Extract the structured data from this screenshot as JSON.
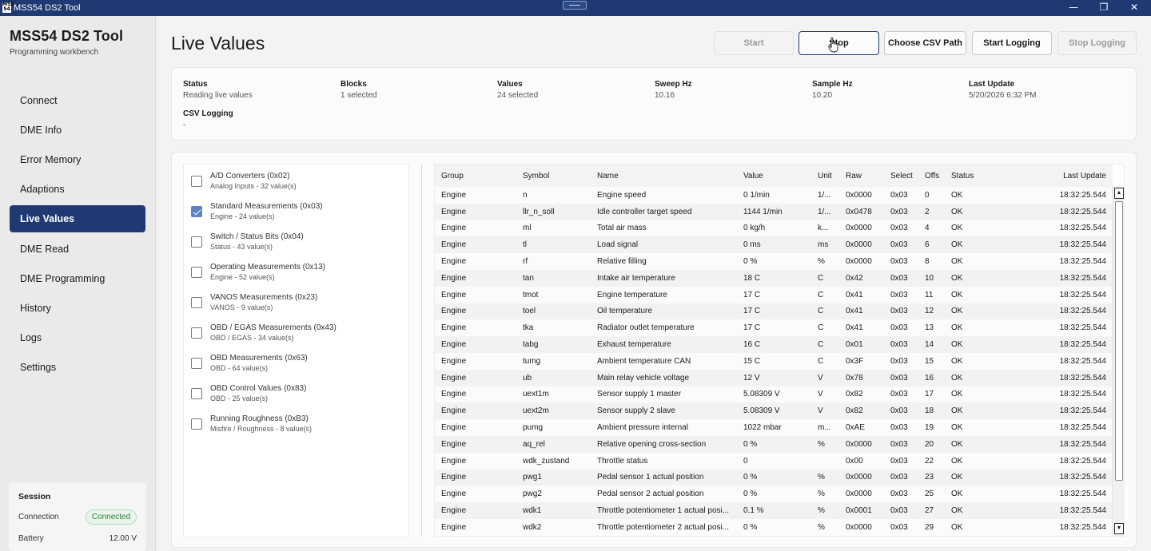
{
  "window": {
    "app_icon_text": "MSS\n54",
    "title": "MSS54 DS2 Tool",
    "minimize": "—",
    "restore": "❐",
    "close": "✕"
  },
  "sidebar": {
    "app_title": "MSS54 DS2 Tool",
    "app_subtitle": "Programming workbench",
    "items": [
      {
        "label": "Connect"
      },
      {
        "label": "DME Info"
      },
      {
        "label": "Error Memory"
      },
      {
        "label": "Adaptions"
      },
      {
        "label": "Live Values"
      },
      {
        "label": "DME Read"
      },
      {
        "label": "DME Programming"
      },
      {
        "label": "History"
      },
      {
        "label": "Logs"
      },
      {
        "label": "Settings"
      }
    ],
    "active_index": 4,
    "session": {
      "title": "Session",
      "connection_label": "Connection",
      "connection_status": "Connected",
      "battery_label": "Battery",
      "battery_value": "12.00 V"
    }
  },
  "header": {
    "page_title": "Live Values",
    "buttons": {
      "start": "Start",
      "stop": "Stop",
      "choose_csv": "Choose CSV Path",
      "start_logging": "Start Logging",
      "stop_logging": "Stop Logging"
    }
  },
  "status": {
    "status_label": "Status",
    "status_value": "Reading live values",
    "blocks_label": "Blocks",
    "blocks_value": "1 selected",
    "values_label": "Values",
    "values_value": "24 selected",
    "sweep_label": "Sweep Hz",
    "sweep_value": "10.16",
    "sample_label": "Sample Hz",
    "sample_value": "10.20",
    "update_label": "Last Update",
    "update_value": "5/20/2026 6:32 PM",
    "csv_label": "CSV Logging",
    "csv_value": "-"
  },
  "blocks": [
    {
      "name": "A/D Converters (0x02)",
      "sub": "Analog Inputs - 32 value(s)",
      "checked": false
    },
    {
      "name": "Standard Measurements (0x03)",
      "sub": "Engine - 24 value(s)",
      "checked": true
    },
    {
      "name": "Switch / Status Bits (0x04)",
      "sub": "Status - 43 value(s)",
      "checked": false
    },
    {
      "name": "Operating Measurements (0x13)",
      "sub": "Engine - 52 value(s)",
      "checked": false
    },
    {
      "name": "VANOS Measurements (0x23)",
      "sub": "VANOS - 9 value(s)",
      "checked": false
    },
    {
      "name": "OBD / EGAS Measurements (0x43)",
      "sub": "OBD / EGAS - 34 value(s)",
      "checked": false
    },
    {
      "name": "OBD Measurements (0x63)",
      "sub": "OBD - 64 value(s)",
      "checked": false
    },
    {
      "name": "OBD Control Values (0x83)",
      "sub": "OBD - 25 value(s)",
      "checked": false
    },
    {
      "name": "Running Roughness (0xB3)",
      "sub": "Misfire / Roughness - 8 value(s)",
      "checked": false
    }
  ],
  "table": {
    "columns": [
      "Group",
      "Symbol",
      "Name",
      "Value",
      "Unit",
      "Raw",
      "Select",
      "Offs",
      "Status",
      "Last Update"
    ],
    "rows": [
      [
        "Engine",
        "n",
        "Engine speed",
        "0 1/min",
        "1/...",
        "0x0000",
        "0x03",
        "0",
        "OK",
        "18:32:25.544"
      ],
      [
        "Engine",
        "llr_n_soll",
        "Idle controller target speed",
        "1144 1/min",
        "1/...",
        "0x0478",
        "0x03",
        "2",
        "OK",
        "18:32:25.544"
      ],
      [
        "Engine",
        "ml",
        "Total air mass",
        "0 kg/h",
        "k...",
        "0x0000",
        "0x03",
        "4",
        "OK",
        "18:32:25.544"
      ],
      [
        "Engine",
        "tl",
        "Load signal",
        "0 ms",
        "ms",
        "0x0000",
        "0x03",
        "6",
        "OK",
        "18:32:25.544"
      ],
      [
        "Engine",
        "rf",
        "Relative filling",
        "0 %",
        "%",
        "0x0000",
        "0x03",
        "8",
        "OK",
        "18:32:25.544"
      ],
      [
        "Engine",
        "tan",
        "Intake air temperature",
        "18 C",
        "C",
        "0x42",
        "0x03",
        "10",
        "OK",
        "18:32:25.544"
      ],
      [
        "Engine",
        "tmot",
        "Engine temperature",
        "17 C",
        "C",
        "0x41",
        "0x03",
        "11",
        "OK",
        "18:32:25.544"
      ],
      [
        "Engine",
        "toel",
        "Oil temperature",
        "17 C",
        "C",
        "0x41",
        "0x03",
        "12",
        "OK",
        "18:32:25.544"
      ],
      [
        "Engine",
        "tka",
        "Radiator outlet temperature",
        "17 C",
        "C",
        "0x41",
        "0x03",
        "13",
        "OK",
        "18:32:25.544"
      ],
      [
        "Engine",
        "tabg",
        "Exhaust temperature",
        "16 C",
        "C",
        "0x01",
        "0x03",
        "14",
        "OK",
        "18:32:25.544"
      ],
      [
        "Engine",
        "tumg",
        "Ambient temperature CAN",
        "15 C",
        "C",
        "0x3F",
        "0x03",
        "15",
        "OK",
        "18:32:25.544"
      ],
      [
        "Engine",
        "ub",
        "Main relay vehicle voltage",
        "12 V",
        "V",
        "0x78",
        "0x03",
        "16",
        "OK",
        "18:32:25.544"
      ],
      [
        "Engine",
        "uext1m",
        "Sensor supply 1 master",
        "5.08309 V",
        "V",
        "0x82",
        "0x03",
        "17",
        "OK",
        "18:32:25.544"
      ],
      [
        "Engine",
        "uext2m",
        "Sensor supply 2 slave",
        "5.08309 V",
        "V",
        "0x82",
        "0x03",
        "18",
        "OK",
        "18:32:25.544"
      ],
      [
        "Engine",
        "pumg",
        "Ambient pressure internal",
        "1022 mbar",
        "m...",
        "0xAE",
        "0x03",
        "19",
        "OK",
        "18:32:25.544"
      ],
      [
        "Engine",
        "aq_rel",
        "Relative opening cross-section",
        "0 %",
        "%",
        "0x0000",
        "0x03",
        "20",
        "OK",
        "18:32:25.544"
      ],
      [
        "Engine",
        "wdk_zustand",
        "Throttle status",
        "0",
        "",
        "0x00",
        "0x03",
        "22",
        "OK",
        "18:32:25.544"
      ],
      [
        "Engine",
        "pwg1",
        "Pedal sensor 1 actual position",
        "0 %",
        "%",
        "0x0000",
        "0x03",
        "23",
        "OK",
        "18:32:25.544"
      ],
      [
        "Engine",
        "pwg2",
        "Pedal sensor 2 actual position",
        "0 %",
        "%",
        "0x0000",
        "0x03",
        "25",
        "OK",
        "18:32:25.544"
      ],
      [
        "Engine",
        "wdk1",
        "Throttle potentiometer 1 actual posi...",
        "0.1 %",
        "%",
        "0x0001",
        "0x03",
        "27",
        "OK",
        "18:32:25.544"
      ],
      [
        "Engine",
        "wdk2",
        "Throttle potentiometer 2 actual posi...",
        "0 %",
        "%",
        "0x0000",
        "0x03",
        "29",
        "OK",
        "18:32:25.544"
      ]
    ]
  },
  "colors": {
    "accent": "#1f3a73",
    "connected_text": "#2f7d3d",
    "checkbox_checked": "#5b83c4"
  }
}
